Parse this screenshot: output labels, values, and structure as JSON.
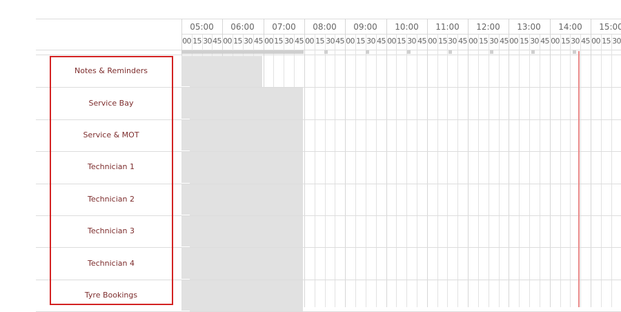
{
  "timeline": {
    "hours": [
      "05:00",
      "06:00",
      "07:00",
      "08:00",
      "09:00",
      "10:00",
      "11:00",
      "12:00",
      "13:00",
      "14:00",
      "15:00"
    ],
    "quarters": [
      "00",
      "15",
      "30",
      "45"
    ]
  },
  "resources": [
    "Notes & Reminders",
    "Service Bay",
    "Service & MOT",
    "Technician 1",
    "Technician 2",
    "Technician 3",
    "Technician 4",
    "Tyre Bookings"
  ],
  "colors": {
    "resource_text": "#7d2d2d",
    "highlight_border": "#d32222",
    "now_line": "#e88b8b",
    "unavailable_shade": "#e1e1e1"
  }
}
